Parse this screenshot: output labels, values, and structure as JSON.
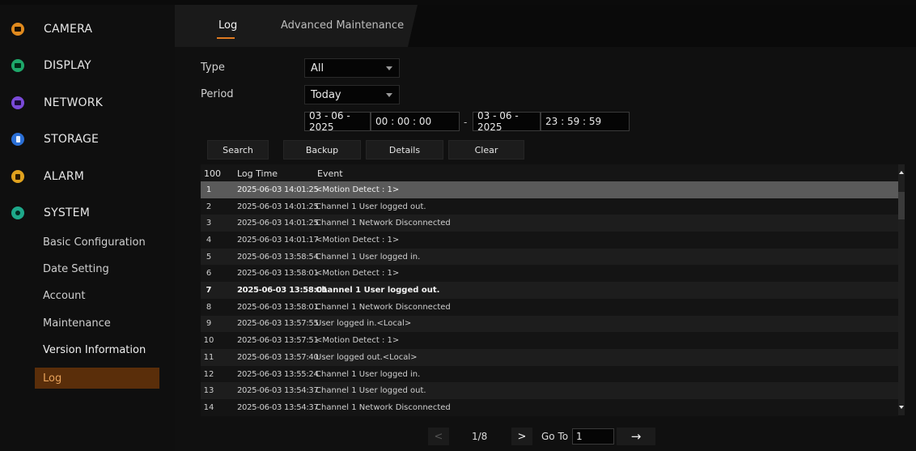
{
  "sidebar": {
    "menu": [
      {
        "label": "CAMERA",
        "icon": "camera-icon",
        "color": "#e08a1e"
      },
      {
        "label": "DISPLAY",
        "icon": "display-icon",
        "color": "#1ea86a"
      },
      {
        "label": "NETWORK",
        "icon": "network-icon",
        "color": "#7a4ad8"
      },
      {
        "label": "STORAGE",
        "icon": "storage-icon",
        "color": "#2a6fd6"
      },
      {
        "label": "ALARM",
        "icon": "alarm-icon",
        "color": "#e0a21e"
      },
      {
        "label": "SYSTEM",
        "icon": "system-icon",
        "color": "#1ea88a"
      }
    ],
    "submenu": [
      {
        "label": "Basic Configuration"
      },
      {
        "label": "Date Setting"
      },
      {
        "label": "Account"
      },
      {
        "label": "Maintenance"
      },
      {
        "label": "Version Information"
      },
      {
        "label": "Log"
      }
    ],
    "accent": "#e07b22"
  },
  "tabs": [
    {
      "label": "Log"
    },
    {
      "label": "Advanced Maintenance"
    }
  ],
  "form": {
    "type_label": "Type",
    "type_value": "All",
    "period_label": "Period",
    "period_value": "Today",
    "start_date": "03 - 06 - 2025",
    "start_time": "00 : 00 : 00",
    "end_date": "03 - 06 - 2025",
    "end_time": "23 : 59 : 59",
    "range_separator": "-"
  },
  "buttons": {
    "search": "Search",
    "backup": "Backup",
    "details": "Details",
    "clear": "Clear"
  },
  "table": {
    "headers": {
      "count": "100",
      "time": "Log Time",
      "event": "Event"
    },
    "rows": [
      {
        "n": "1",
        "time": "2025-06-03 14:01:25",
        "event": "<Motion Detect : 1>"
      },
      {
        "n": "2",
        "time": "2025-06-03 14:01:25",
        "event": "Channel 1 User logged out."
      },
      {
        "n": "3",
        "time": "2025-06-03 14:01:25",
        "event": "Channel 1 Network Disconnected"
      },
      {
        "n": "4",
        "time": "2025-06-03 14:01:17",
        "event": "<Motion Detect : 1>"
      },
      {
        "n": "5",
        "time": "2025-06-03 13:58:54",
        "event": "Channel 1 User logged in."
      },
      {
        "n": "6",
        "time": "2025-06-03 13:58:01",
        "event": "<Motion Detect : 1>"
      },
      {
        "n": "7",
        "time": "2025-06-03 13:58:01",
        "event": "Channel 1 User logged out."
      },
      {
        "n": "8",
        "time": "2025-06-03 13:58:01",
        "event": "Channel 1 Network Disconnected"
      },
      {
        "n": "9",
        "time": "2025-06-03 13:57:55",
        "event": "User logged in.<Local>"
      },
      {
        "n": "10",
        "time": "2025-06-03 13:57:51",
        "event": "<Motion Detect : 1>"
      },
      {
        "n": "11",
        "time": "2025-06-03 13:57:40",
        "event": "User logged out.<Local>"
      },
      {
        "n": "12",
        "time": "2025-06-03 13:55:24",
        "event": "Channel 1 User logged in."
      },
      {
        "n": "13",
        "time": "2025-06-03 13:54:37",
        "event": "Channel 1 User logged out."
      },
      {
        "n": "14",
        "time": "2025-06-03 13:54:37",
        "event": "Channel 1 Network Disconnected"
      }
    ]
  },
  "pagination": {
    "prev": "<",
    "next": ">",
    "page_info": "1/8",
    "goto_label": "Go To",
    "goto_value": "1",
    "goto_button": "→"
  }
}
